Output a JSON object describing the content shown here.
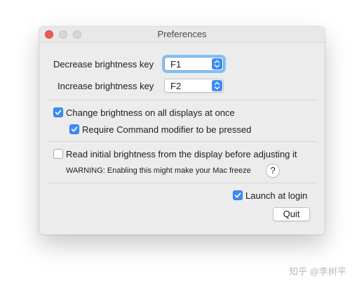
{
  "window": {
    "title": "Preferences"
  },
  "keys": {
    "decrease_label": "Decrease brightness key",
    "decrease_value": "F1",
    "increase_label": "Increase brightness key",
    "increase_value": "F2"
  },
  "options": {
    "all_displays_label": "Change brightness on all displays at once",
    "all_displays_checked": true,
    "require_command_label": "Require Command modifier to be pressed",
    "require_command_checked": true,
    "read_initial_label": "Read initial brightness from the display before adjusting it",
    "read_initial_checked": false,
    "warning_text": "WARNING: Enabling this might make your Mac freeze",
    "help_label": "?",
    "launch_at_login_label": "Launch at login",
    "launch_at_login_checked": true
  },
  "buttons": {
    "quit_label": "Quit"
  },
  "watermark": {
    "text": "知乎 @李树平"
  },
  "colors": {
    "accent": "#3b8cf5",
    "close_button": "#ee5b57",
    "window_bg": "#ececec"
  },
  "icons": {
    "close": "close-icon",
    "minimize": "minimize-icon",
    "zoom": "zoom-icon",
    "popup_arrows": "chevron-up-down-icon",
    "checkmark": "checkmark-icon"
  }
}
